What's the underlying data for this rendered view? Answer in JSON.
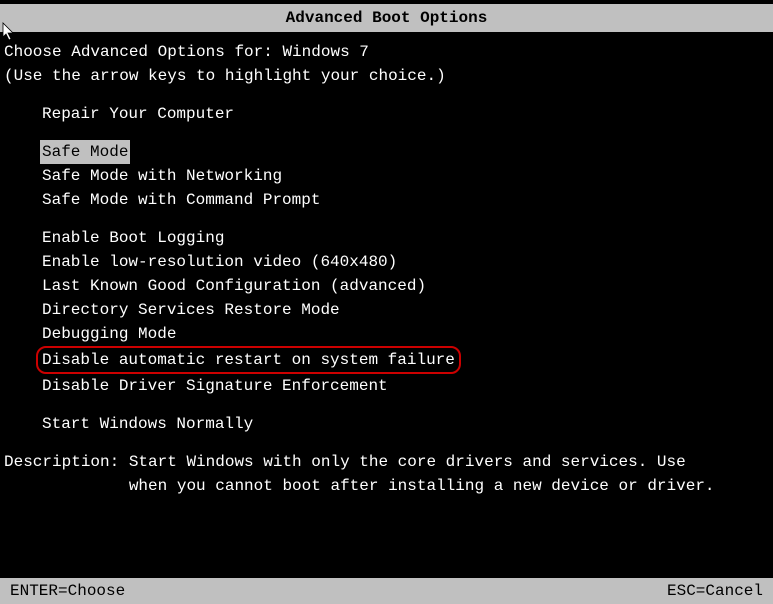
{
  "title": "Advanced Boot Options",
  "prompt_prefix": "Choose Advanced Options for: ",
  "os_name": "Windows 7",
  "instruction": "(Use the arrow keys to highlight your choice.)",
  "groups": [
    {
      "items": [
        {
          "label": "Repair Your Computer",
          "selected": false,
          "circled": false
        }
      ]
    },
    {
      "items": [
        {
          "label": "Safe Mode",
          "selected": true,
          "circled": false
        },
        {
          "label": "Safe Mode with Networking",
          "selected": false,
          "circled": false
        },
        {
          "label": "Safe Mode with Command Prompt",
          "selected": false,
          "circled": false
        }
      ]
    },
    {
      "items": [
        {
          "label": "Enable Boot Logging",
          "selected": false,
          "circled": false
        },
        {
          "label": "Enable low-resolution video (640x480)",
          "selected": false,
          "circled": false
        },
        {
          "label": "Last Known Good Configuration (advanced)",
          "selected": false,
          "circled": false
        },
        {
          "label": "Directory Services Restore Mode",
          "selected": false,
          "circled": false
        },
        {
          "label": "Debugging Mode",
          "selected": false,
          "circled": false
        },
        {
          "label": "Disable automatic restart on system failure",
          "selected": false,
          "circled": true
        },
        {
          "label": "Disable Driver Signature Enforcement",
          "selected": false,
          "circled": false
        }
      ]
    },
    {
      "items": [
        {
          "label": "Start Windows Normally",
          "selected": false,
          "circled": false
        }
      ]
    }
  ],
  "description_label": "Description: ",
  "description_text": "Start Windows with only the core drivers and services. Use\n             when you cannot boot after installing a new device or driver.",
  "footer": {
    "enter": "ENTER=Choose",
    "esc": "ESC=Cancel"
  }
}
